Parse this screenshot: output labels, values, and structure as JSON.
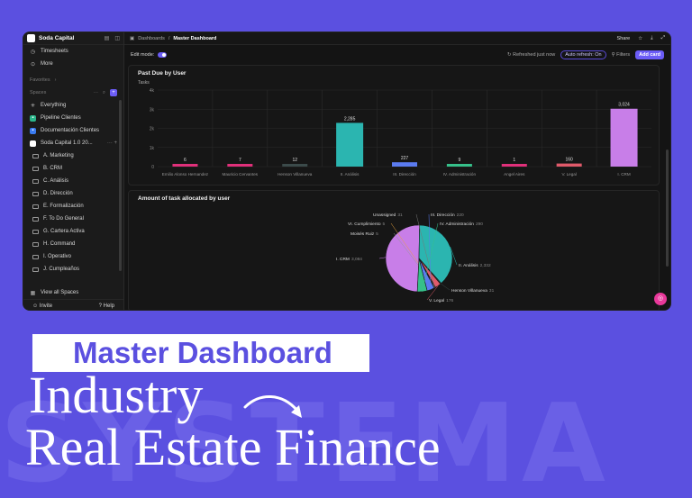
{
  "watermark": "SYSTEMA",
  "sidebar": {
    "workspace": "Soda Capital",
    "top_items": [
      {
        "label": "Timesheets",
        "icon": "clock-icon"
      },
      {
        "label": "More",
        "icon": "more-icon"
      }
    ],
    "favorites_label": "Favorites",
    "spaces_label": "Spaces",
    "items": [
      {
        "label": "Everything",
        "icon": "everything-icon"
      },
      {
        "label": "Pipeline Clientes",
        "icon": "pipeline-icon"
      },
      {
        "label": "Documentación Clientes",
        "icon": "doc-icon"
      },
      {
        "label": "Soda Capital 1.0 20...",
        "icon": "space-icon"
      }
    ],
    "folders": [
      "A. Marketing",
      "B. CRM",
      "C. Análisis",
      "D. Dirección",
      "E. Formalización",
      "F. To Do General",
      "G. Cartera Activa",
      "H. Command",
      "I. Operativo",
      "J. Cumpleaños"
    ],
    "view_all": "View all Spaces",
    "invite": "Invite",
    "help": "Help"
  },
  "topbar": {
    "crumb": "Dashboards",
    "current": "Master Dashboard",
    "share": "Share"
  },
  "subbar": {
    "edit_mode": "Edit mode:",
    "refreshed": "Refreshed just now",
    "auto_refresh": "Auto refresh: On",
    "filters": "Filters",
    "add_card": "Add card"
  },
  "chart1_title": "Past Due by User",
  "chart2_title": "Amount of task allocated by user",
  "chart_data": [
    {
      "type": "bar",
      "title": "Past Due by User",
      "ylabel": "Tasks",
      "yticks": [
        "4k",
        "3k",
        "2k",
        "1k",
        "0"
      ],
      "ylim": [
        0,
        4000
      ],
      "categories": [
        "Emilio Alonso Hernandez",
        "Mauricio Cervantes",
        "Henson Villanueva",
        "II. Análisis",
        "III. Dirección",
        "IV. Administración",
        "Angel Aires",
        "V. Legal",
        "I. CRM"
      ],
      "values": [
        6,
        7,
        12,
        2285,
        227,
        9,
        1,
        160,
        3024
      ],
      "value_labels": [
        "6",
        "7",
        "12",
        "2,285",
        "227",
        "9",
        "1",
        "160",
        "3,024"
      ],
      "colors": [
        "#e0307a",
        "#e0307a",
        "#3b4a4a",
        "#2bb5b0",
        "#5b7bf0",
        "#36c08a",
        "#e0307a",
        "#e05a6a",
        "#c87ee8"
      ],
      "grid": true
    },
    {
      "type": "pie",
      "title": "Amount of task allocated by user",
      "slices": [
        {
          "label": "I. CRM",
          "value": 3024,
          "value_label": "3,084",
          "color": "#c87ee8"
        },
        {
          "label": "II. Análisis",
          "value": 2332,
          "value_label": "2,332",
          "color": "#2bb5b0"
        },
        {
          "label": "Henson Villanueva",
          "value": 31,
          "value_label": "31",
          "color": "#3b4a4a"
        },
        {
          "label": "V. Legal",
          "value": 176,
          "value_label": "176",
          "color": "#e05a6a"
        },
        {
          "label": "Moisés Ruiz",
          "value": 5,
          "value_label": "5",
          "color": "#999999"
        },
        {
          "label": "VI. Cumplimiento",
          "value": 5,
          "value_label": "5",
          "color": "#e6a23c"
        },
        {
          "label": "Unassigned",
          "value": 31,
          "value_label": "31",
          "color": "#777777"
        },
        {
          "label": "III. Dirección",
          "value": 220,
          "value_label": "220",
          "color": "#5b7bf0"
        },
        {
          "label": "IV. Administración",
          "value": 290,
          "value_label": "290",
          "color": "#36c08a"
        }
      ]
    }
  ],
  "banner": {
    "badge": "Master Dashboard",
    "line1": "Industry",
    "line2": "Real Estate Finance"
  }
}
